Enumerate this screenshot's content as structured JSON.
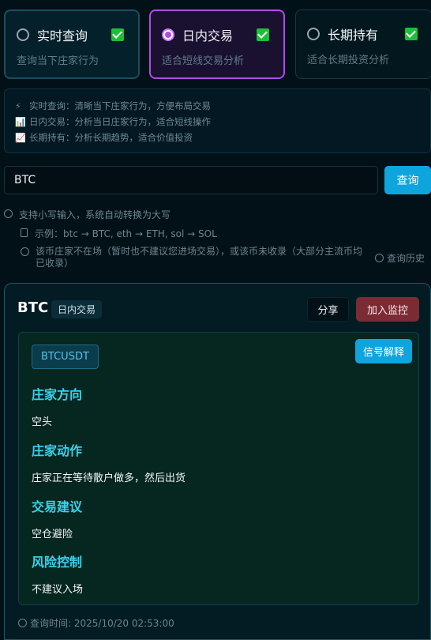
{
  "modes": [
    {
      "title": "实时查询",
      "desc": "查询当下庄家行为",
      "selected": false,
      "checked": true
    },
    {
      "title": "日内交易",
      "desc": "适合短线交易分析",
      "selected": true,
      "checked": true
    },
    {
      "title": "长期持有",
      "desc": "适合长期投资分析",
      "selected": false,
      "checked": true
    }
  ],
  "info": [
    {
      "icon": "⚡",
      "text": "实时查询：清晰当下庄家行为，方便布局交易"
    },
    {
      "icon": "📊",
      "text": "日内交易：分析当日庄家行为，适合短线操作"
    },
    {
      "icon": "📈",
      "text": "长期持有：分析长期趋势，适合价值投资"
    }
  ],
  "search": {
    "value": "BTC",
    "button": "查询"
  },
  "hints": {
    "uppercase": "支持小写输入，系统自动转换为大写",
    "example": "示例：btc → BTC, eth → ETH, sol → SOL",
    "notice": "该币庄家不在场（暂时也不建议您进场交易），或该币未收录（大部分主流币均已收录）",
    "history": "查询历史"
  },
  "result": {
    "symbol": "BTC",
    "mode_tag": "日内交易",
    "share": "分享",
    "monitor": "加入监控",
    "pair": "BTCUSDT",
    "explain": "信号解释",
    "sections": [
      {
        "heading": "庄家方向",
        "value": "空头"
      },
      {
        "heading": "庄家动作",
        "value": "庄家正在等待散户做多，然后出货"
      },
      {
        "heading": "交易建议",
        "value": "空仓避险"
      },
      {
        "heading": "风险控制",
        "value": "不建议入场"
      }
    ],
    "query_time": "查询时间: 2025/10/20 02:53:00"
  },
  "colors": {
    "accent": "#0ea5de",
    "selected_border": "#b04ae8",
    "heading": "#35d4ec",
    "danger": "#7a2b34"
  }
}
